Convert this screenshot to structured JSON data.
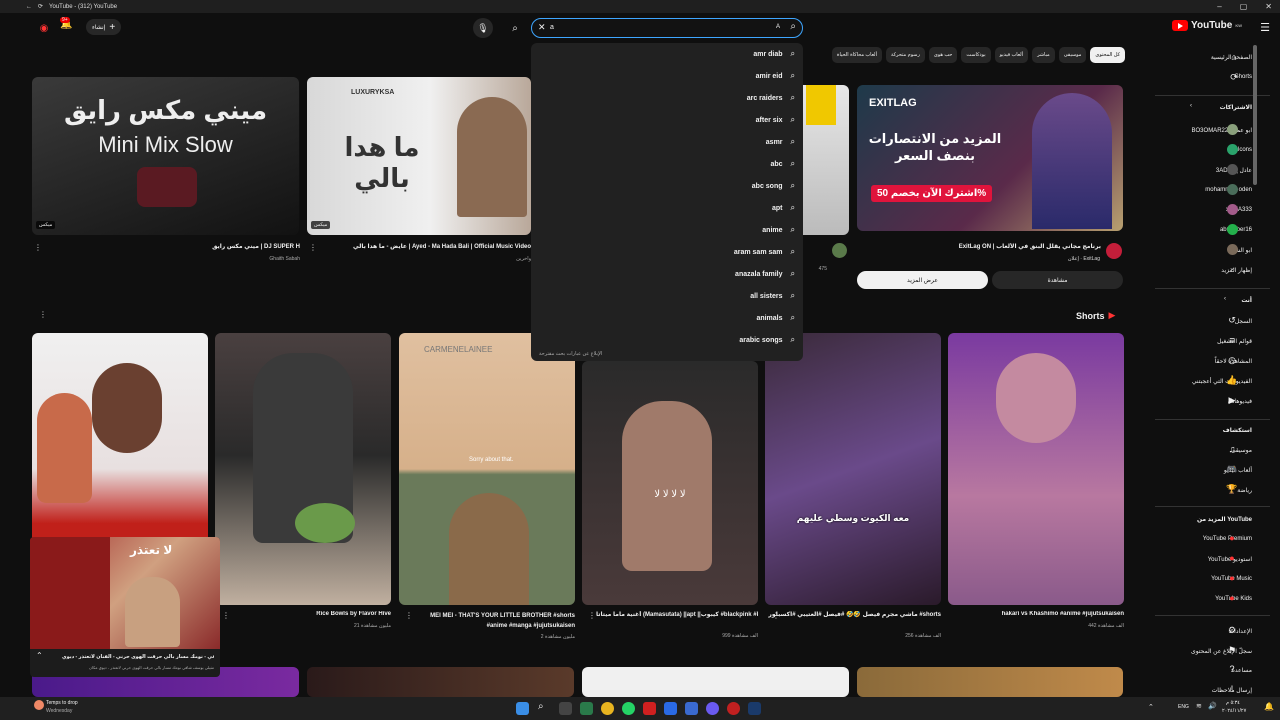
{
  "titlebar": {
    "title": "YouTube - (312) YouTube"
  },
  "header": {
    "create_label": "إنشاء",
    "notif_count": "9+",
    "search_value": "a",
    "search_hint": "A",
    "logo_text": "YouTube",
    "logo_region": "KW"
  },
  "chips": [
    "كل المحتوى",
    "موسيقى",
    "مباشر",
    "ألعاب فيديو",
    "بودكاست",
    "حب هوى",
    "رسوم متحركة",
    "ألعاب محاكاة الحياة"
  ],
  "dropdown": {
    "suggestions": [
      "amr diab",
      "amir eid",
      "arc raiders",
      "after six",
      "asmr",
      "abc",
      "abc song",
      "apt",
      "anime",
      "aram sam sam",
      "anazala family",
      "all sisters",
      "animals",
      "arabic songs"
    ],
    "report": "الإبلاغ عن عبارات بحث مقترحة"
  },
  "sidebar": {
    "main": [
      {
        "label": "الصفحة الرئيسية",
        "icon": "home-icon"
      },
      {
        "label": "Shorts",
        "icon": "shorts-icon"
      }
    ],
    "subs_heading": "الاشتراكات",
    "subs": [
      {
        "label": "BO3OMAR22 - ابو عمر",
        "color": "#8aa07c"
      },
      {
        "label": "Falcons",
        "color": "#2aa36b"
      },
      {
        "label": "3ADEL | عادل",
        "color": "#555"
      },
      {
        "label": "mohammed oden",
        "color": "#4a6d5a"
      },
      {
        "label": "xSMA333",
        "color": "#a35b8a"
      },
      {
        "label": "abu_aber16",
        "color": "#23b04b"
      },
      {
        "label": "ابو الشيخ",
        "color": "#7a6a5a"
      },
      {
        "label": "إظهار المزيد"
      }
    ],
    "you_heading": "أنت",
    "you": [
      {
        "label": "السجل",
        "icon": "history-icon"
      },
      {
        "label": "قوائم التشغيل",
        "icon": "playlist-icon"
      },
      {
        "label": "المشاهدة لاحقاً",
        "icon": "clock-icon"
      },
      {
        "label": "الفيديوهات التي أعجبتني",
        "icon": "thumbs-up-icon"
      },
      {
        "label": "فيديوهاتك",
        "icon": "video-icon"
      }
    ],
    "explore_heading": "استكشاف",
    "explore": [
      {
        "label": "موسيقى",
        "icon": "music-icon"
      },
      {
        "label": "ألعاب فيديو",
        "icon": "gamepad-icon"
      },
      {
        "label": "رياضة",
        "icon": "trophy-icon"
      }
    ],
    "more_heading": "المزيد من YouTube",
    "more": [
      {
        "label": "YouTube Premium"
      },
      {
        "label": "YouTube استوديو"
      },
      {
        "label": "YouTube Music"
      },
      {
        "label": "YouTube Kids"
      }
    ],
    "settings": [
      {
        "label": "الإعدادات",
        "icon": "gear-icon"
      },
      {
        "label": "سجلّ الإبلاغ عن المحتوى",
        "icon": "flag-icon"
      },
      {
        "label": "مساعدة",
        "icon": "help-icon"
      },
      {
        "label": "إرسال ملاحظات",
        "icon": "feedback-icon"
      }
    ]
  },
  "videos": [
    {
      "title": "ميني مكس رايق | DJ SUPER H",
      "channel": "Ghaith Sabah",
      "thumb_text": "ميني مكس رايق",
      "thumb_text2": "Mini Mix Slow",
      "badge": "ميكس"
    },
    {
      "title": "عايض - ما هدا بالي | Ayed - Ma Hada Bali | Official Music Video",
      "channel": "وآخرين",
      "thumb_text": "ما هدا بالي",
      "thumb_brand": "LUXURYKSA",
      "badge": "ميكس"
    },
    {
      "title": "",
      "channel": "",
      "views": "475"
    },
    {
      "title": "ExitLag ON | برنامج مجاني يقلل البنق في الألعاب",
      "channel": "ExitLag",
      "sponsor": "إعلان",
      "thumb_brand": "EXITLAG",
      "thumb_text": "المزيد من الانتصارات بنصف السعر",
      "thumb_offer": "اشترك الآن بخصم 50%",
      "btn_watch": "مشاهدة",
      "btn_more": "عرض المزيد"
    }
  ],
  "shorts": {
    "heading": "Shorts",
    "items": [
      {
        "title": "hakari vs Khashimo #anime #jujutsukaisen",
        "views": "442 ألف مشاهدة"
      },
      {
        "title": "ماشي مجرم فيصل 🤣🤣 #فيصل #العتيبي #اكسبلور #shorts",
        "views": "256 ألف مشاهدة",
        "overlay": "معه الكيوت وسطي عليهم"
      },
      {
        "title": "أغنية ماما ميتاتا (Mamasutata) ||apt ||كيبوب #blackpink #kpop #explore #explorepage",
        "views": "999 ألف مشاهدة",
        "overlay": "لا لا لا لا"
      },
      {
        "title": "MEI MEI - THAT'S YOUR LITTLE BROTHER #shorts #anime #manga #jujutsukaisen",
        "views": "2 مليون مشاهدة",
        "overlay": "Sorry about that.",
        "watermark": "CARMENELAINEE"
      },
      {
        "title": "Rice Bowls by Flavor Hive",
        "views": "21 مليون مشاهدة"
      },
      {
        "title": "",
        "views": ""
      }
    ]
  },
  "miniplayer": {
    "title": "يوسف شافي - نومك مسار بالي حرقت الهوى حرني - الفنان لاتعتذر - ديوي...",
    "subtitle": "مثيلي يوسف شافي نومك مسار بالي حرقت الهوى حرني لاتعتذر - ديوي مكان",
    "cover_text": "لا تعتذر"
  },
  "taskbar": {
    "weather": "Temps to drop",
    "weather_sub": "Wednesday",
    "lang": "ENG",
    "time": "٥:٣٤ م",
    "date": "٢٠٢٤/١١/٢٧"
  }
}
